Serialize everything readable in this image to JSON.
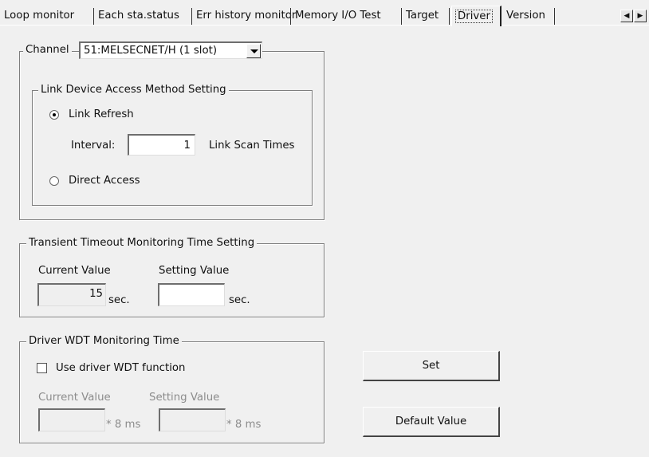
{
  "tabs": [
    {
      "label": "Loop monitor"
    },
    {
      "label": "Each sta.status"
    },
    {
      "label": "Err history monitor"
    },
    {
      "label": "Memory I/O Test"
    },
    {
      "label": "Target"
    },
    {
      "label": "Driver"
    },
    {
      "label": "Version"
    }
  ],
  "active_tab": "Driver",
  "channel": {
    "label": "Channel",
    "selected": "51:MELSECNET/H (1 slot)"
  },
  "link_access": {
    "title": "Link Device Access Method Setting",
    "option_refresh": "Link Refresh",
    "option_direct": "Direct Access",
    "selected": "Link Refresh",
    "interval_label": "Interval:",
    "interval_value": "1",
    "interval_unit": "Link Scan Times"
  },
  "transient": {
    "title": "Transient Timeout Monitoring Time Setting",
    "current_label": "Current Value",
    "setting_label": "Setting Value",
    "current_value": "15",
    "unit": "sec.",
    "setting_value": ""
  },
  "wdt": {
    "title": "Driver WDT Monitoring Time",
    "checkbox_label": "Use driver WDT function",
    "checked": false,
    "current_label": "Current Value",
    "setting_label": "Setting Value",
    "unit": "* 8 ms",
    "current_value": "",
    "setting_value": ""
  },
  "buttons": {
    "set": "Set",
    "default": "Default Value"
  }
}
